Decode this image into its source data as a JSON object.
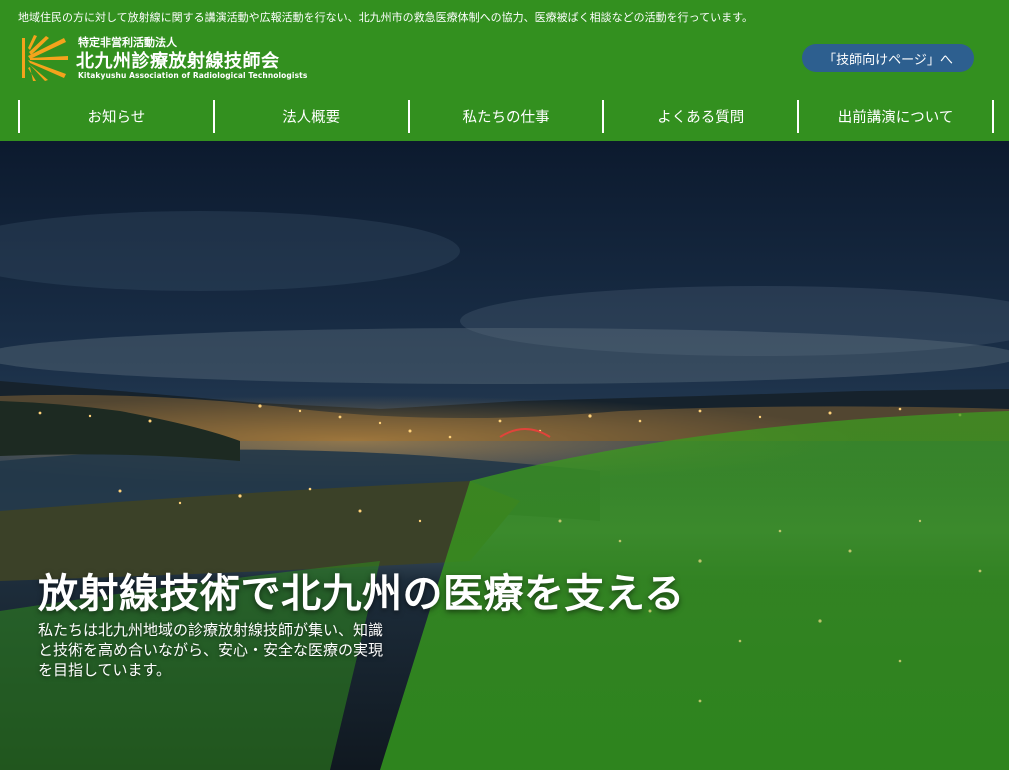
{
  "header": {
    "tagline": "地域住民の方に対して放射線に関する講演活動や広報活動を行ない、北九州市の救急医療体制への協力、医療被ばく相談などの活動を行っています。",
    "logo": {
      "subtitle": "特定非営利活動法人",
      "name": "北九州診療放射線技師会",
      "english": "Kitakyushu Association of Radiological Technologists",
      "icon": "radiation-burst-logo-icon"
    },
    "pro_button_label": "「技師向けページ」へ"
  },
  "nav": {
    "items": [
      {
        "label": "お知らせ"
      },
      {
        "label": "法人概要"
      },
      {
        "label": "私たちの仕事"
      },
      {
        "label": "よくある質問"
      },
      {
        "label": "出前講演について"
      }
    ]
  },
  "hero": {
    "title": "放射線技術で北九州の医療を支える",
    "lines": [
      "私たちは北九州地域の診療放射線技師が集い、知識",
      "と技術を高め合いながら、安心・安全な医療の実現",
      "を目指しています。"
    ]
  },
  "colors": {
    "header_green": "#33901f",
    "button_blue": "#2d5f8f",
    "logo_orange": "#f4a31c",
    "overlay_green": "#3d9a1f"
  }
}
